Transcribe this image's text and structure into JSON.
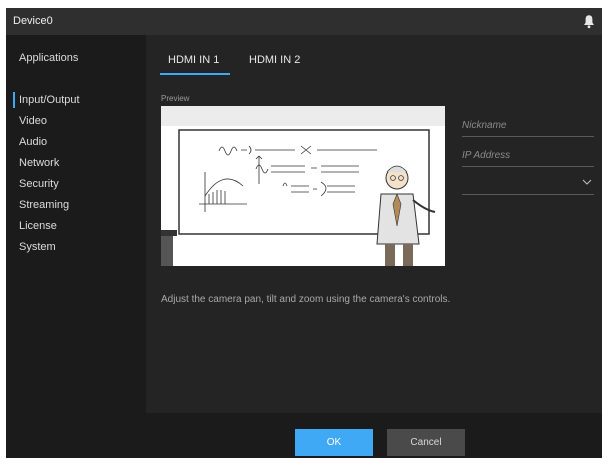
{
  "window": {
    "title": "Device0",
    "notification_icon": "bell-icon"
  },
  "sidebar": {
    "items": [
      {
        "label": "Applications",
        "active": false
      },
      {
        "label": "Input/Output",
        "active": true
      },
      {
        "label": "Video",
        "active": false
      },
      {
        "label": "Audio",
        "active": false
      },
      {
        "label": "Network",
        "active": false
      },
      {
        "label": "Security",
        "active": false
      },
      {
        "label": "Streaming",
        "active": false
      },
      {
        "label": "License",
        "active": false
      },
      {
        "label": "System",
        "active": false
      }
    ]
  },
  "main": {
    "tabs": [
      {
        "label": "HDMI IN 1",
        "selected": true
      },
      {
        "label": "HDMI IN 2",
        "selected": false
      }
    ],
    "preview_label": "Preview",
    "help_text": "Adjust the camera pan, tilt and zoom using the camera's controls.",
    "nickname": {
      "value": "",
      "placeholder": "Nickname"
    },
    "ip_address": {
      "value": "",
      "placeholder": "IP Address"
    },
    "select": {
      "value": ""
    }
  },
  "footer": {
    "ok_label": "OK",
    "cancel_label": "Cancel"
  },
  "colors": {
    "accent": "#3fa9f5",
    "background": "#1e1e1e",
    "titlebar": "#2f2f2f"
  }
}
